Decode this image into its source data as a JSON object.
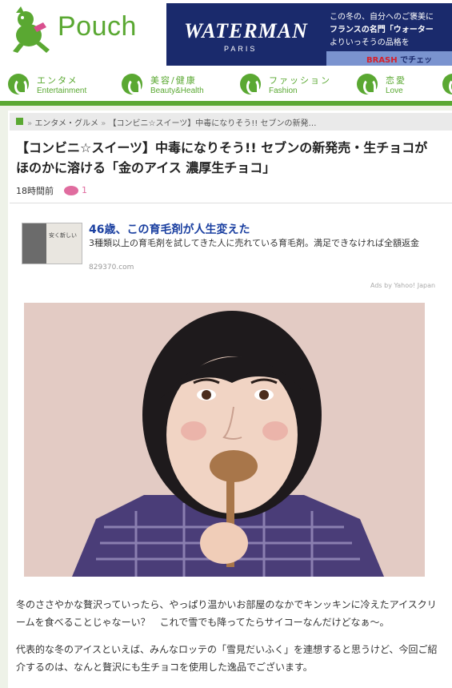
{
  "header": {
    "logo_text": "Pouch",
    "ad": {
      "brand": "WATERMAN",
      "sub": "PARIS",
      "line1": "この冬の、自分へのご褒美に",
      "line2": "フランスの名門「ウォーター",
      "line3": "よりいっそうの品格を",
      "brash": "BRASH",
      "brash_rest": "でチェッ"
    }
  },
  "nav": [
    {
      "jp": "エンタメ",
      "en": "Entertainment"
    },
    {
      "jp": "美容/健康",
      "en": "Beauty&Health"
    },
    {
      "jp": "ファッション",
      "en": "Fashion"
    },
    {
      "jp": "恋愛",
      "en": "Love"
    }
  ],
  "breadcrumb": {
    "sep": "»",
    "items": [
      "エンタメ・グルメ",
      "【コンビニ☆スイーツ】中毒になりそう!! セブンの新発…"
    ]
  },
  "article": {
    "title": "【コンビニ☆スイーツ】中毒になりそう!! セブンの新発売・生チョコがほのかに溶ける「金のアイス 濃厚生チョコ」",
    "time": "18時間前",
    "comments": "1",
    "paragraphs": [
      "冬のささやかな贅沢っていったら、やっぱり温かいお部屋のなかでキンッキンに冷えたアイスクリームを食べることじゃなーい？　これで雪でも降ってたらサイコーなんだけどなぁ〜。",
      "代表的な冬のアイスといえば、みんなロッテの「雪見だいふく」を連想すると思うけど、今回ご紹介するのは、なんと贅沢にも生チョコを使用した逸品でございます。"
    ]
  },
  "sponsored": {
    "title": "46歳、この育毛剤が人生変えた",
    "description": "3種類以上の育毛剤を試してきた人に売れている育毛剤。満足できなければ全額返金",
    "url": "829370.com",
    "thumb_text": "安く新しい",
    "ads_by": "Ads by Yahoo! Japan"
  },
  "colors": {
    "brand_green": "#5aa832",
    "link_blue": "#1a3fa0",
    "comment_pink": "#e06c9f",
    "ad_navy": "#1a2a6c"
  }
}
